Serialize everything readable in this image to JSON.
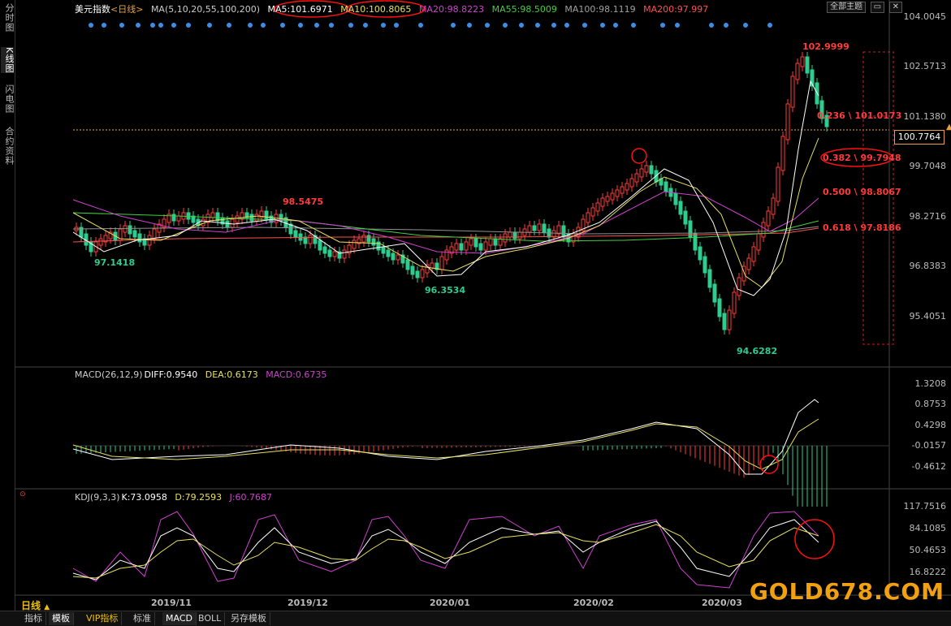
{
  "left_tabs": [
    {
      "label": "分时图",
      "active": false
    },
    {
      "label": "K线图",
      "active": true
    },
    {
      "label": "闪电图",
      "active": false
    },
    {
      "label": "合约资料",
      "active": false
    }
  ],
  "header": {
    "symbol": "美元指数",
    "period": "<日线>",
    "ma_params": "MA(5,10,20,55,100,200)",
    "ma5": "MA5:101.6971",
    "ma10": "MA10:100.8065",
    "ma20": "MA20:98.8223",
    "ma55": "MA55:98.5009",
    "ma100": "MA100:98.1119",
    "ma200": "MA200:97.997"
  },
  "top_right": {
    "theme_label": "全部主题"
  },
  "price_axis": [
    "104.0045",
    "102.5713",
    "101.1380",
    "99.7048",
    "98.2716",
    "96.8383",
    "95.4051"
  ],
  "current_price": "100.7764",
  "annotations": {
    "high": "102.9999",
    "peak_left": "98.5475",
    "low_left": "97.1418",
    "low_mid": "96.3534",
    "low_main": "94.6282"
  },
  "fib_levels": [
    {
      "label": "0.236 \\ 101.0173"
    },
    {
      "label": "0.382 \\ 99.7948"
    },
    {
      "label": "0.500 \\ 98.8067"
    },
    {
      "label": "0.618 \\ 97.8186"
    }
  ],
  "macd": {
    "title": "MACD(26,12,9)",
    "diff": "DIFF:0.9540",
    "dea": "DEA:0.6173",
    "macd": "MACD:0.6735",
    "axis": [
      "1.3208",
      "0.8753",
      "0.4298",
      "-0.0157",
      "-0.4612"
    ]
  },
  "kdj": {
    "title": "KDJ(9,3,3)",
    "k": "K:73.0958",
    "d": "D:79.2593",
    "j": "J:60.7687",
    "axis": [
      "117.7516",
      "84.1085",
      "50.4653",
      "16.8222"
    ]
  },
  "date_labels": [
    "2019/11",
    "2019/12",
    "2020/01",
    "2020/02",
    "2020/03"
  ],
  "period_selector": "日线",
  "bottom_tabs": [
    {
      "label": "指标",
      "selected": false,
      "gold": false
    },
    {
      "label": "模板",
      "selected": true,
      "gold": false
    },
    {
      "label": "VIP指标",
      "selected": false,
      "gold": true
    },
    {
      "label": "标准",
      "selected": false,
      "gold": false
    },
    {
      "label": "MACD",
      "selected": true,
      "gold": false
    },
    {
      "label": "BOLL",
      "selected": false,
      "gold": false
    },
    {
      "label": "另存模板",
      "selected": false,
      "gold": false
    }
  ],
  "watermark": "GOLD678.COM",
  "colors": {
    "up": "#ff3c3c",
    "down": "#2ecc8f",
    "ma5": "#ffffff",
    "ma10": "#e8e060",
    "ma20": "#d040d0",
    "ma55": "#40d040",
    "ma100": "#a0a0a0",
    "ma200": "#ff5050",
    "accent": "#ff2020"
  }
}
